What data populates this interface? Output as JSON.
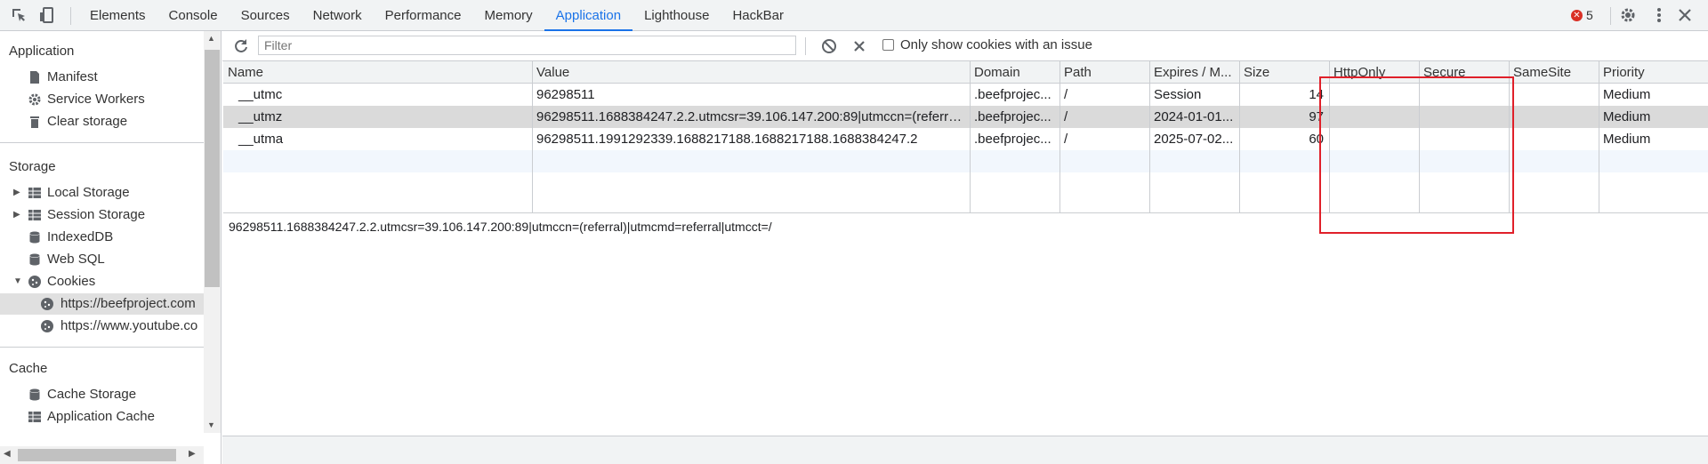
{
  "topbar": {
    "tabs": [
      {
        "label": "Elements"
      },
      {
        "label": "Console"
      },
      {
        "label": "Sources"
      },
      {
        "label": "Network"
      },
      {
        "label": "Performance"
      },
      {
        "label": "Memory"
      },
      {
        "label": "Application",
        "active": true
      },
      {
        "label": "Lighthouse"
      },
      {
        "label": "HackBar"
      }
    ],
    "error_count": "5"
  },
  "sidebar": {
    "application_header": "Application",
    "application_items": [
      "Manifest",
      "Service Workers",
      "Clear storage"
    ],
    "storage_header": "Storage",
    "storage_items": [
      "Local Storage",
      "Session Storage",
      "IndexedDB",
      "Web SQL",
      "Cookies"
    ],
    "cookie_origins": [
      "https://beefproject.com",
      "https://www.youtube.co"
    ],
    "cache_header": "Cache",
    "cache_items": [
      "Cache Storage",
      "Application Cache"
    ]
  },
  "toolbar": {
    "filter_placeholder": "Filter",
    "only_issues_label": "Only show cookies with an issue"
  },
  "table": {
    "columns": [
      "Name",
      "Value",
      "Domain",
      "Path",
      "Expires / M...",
      "Size",
      "HttpOnly",
      "Secure",
      "SameSite",
      "Priority"
    ],
    "rows": [
      {
        "name": "__utmc",
        "value": "96298511",
        "domain": ".beefprojec...",
        "path": "/",
        "expires": "Session",
        "size": "14",
        "httponly": "",
        "secure": "",
        "samesite": "",
        "priority": "Medium"
      },
      {
        "name": "__utmz",
        "value": "96298511.1688384247.2.2.utmcsr=39.106.147.200:89|utmccn=(referral)...",
        "domain": ".beefprojec...",
        "path": "/",
        "expires": "2024-01-01...",
        "size": "97",
        "httponly": "",
        "secure": "",
        "samesite": "",
        "priority": "Medium",
        "selected": true
      },
      {
        "name": "__utma",
        "value": "96298511.1991292339.1688217188.1688217188.1688384247.2",
        "domain": ".beefprojec...",
        "path": "/",
        "expires": "2025-07-02...",
        "size": "60",
        "httponly": "",
        "secure": "",
        "samesite": "",
        "priority": "Medium"
      }
    ]
  },
  "preview_value": "96298511.1688384247.2.2.utmcsr=39.106.147.200:89|utmccn=(referral)|utmcmd=referral|utmcct=/",
  "colors": {
    "accent": "#1a73e8",
    "annotation": "#e0202a",
    "error": "#d93025"
  }
}
